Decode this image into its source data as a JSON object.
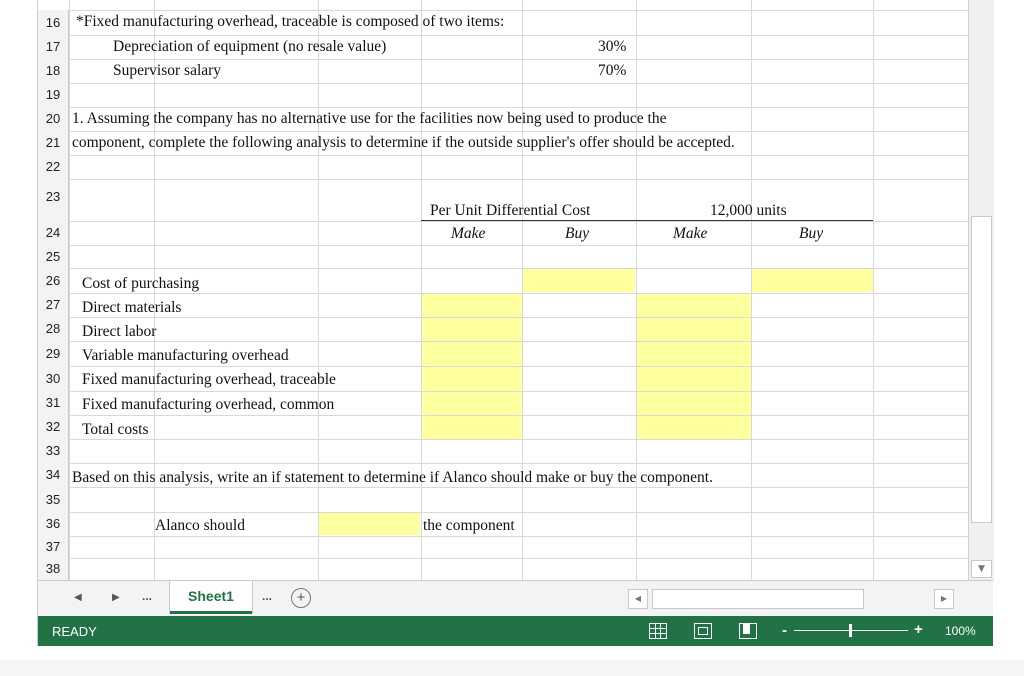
{
  "rows": [
    "16",
    "17",
    "18",
    "19",
    "20",
    "21",
    "22",
    "23",
    "24",
    "25",
    "26",
    "27",
    "28",
    "29",
    "30",
    "31",
    "32",
    "33",
    "34",
    "35",
    "36",
    "37",
    "38"
  ],
  "cells": {
    "r16": "*Fixed manufacturing overhead, traceable is composed of two items:",
    "r17_label": "Depreciation of equipment (no resale value)",
    "r17_value": "30%",
    "r18_label": "Supervisor salary",
    "r18_value": "70%",
    "r20": "1. Assuming the company has no alternative use for the facilities now being used to produce the",
    "r21": "component, complete the following analysis to determine if the outside supplier's offer should be accepted.",
    "r23_per_unit": "Per Unit Differential Cost",
    "r23_units": "12,000 units",
    "r24_make1": "Make",
    "r24_buy1": "Buy",
    "r24_make2": "Make",
    "r24_buy2": "Buy",
    "r26": "Cost of purchasing",
    "r27": "Direct materials",
    "r28": "Direct labor",
    "r29": "Variable manufacturing overhead",
    "r30": "Fixed manufacturing overhead, traceable",
    "r31": "Fixed manufacturing overhead, common",
    "r32": "Total costs",
    "r34": "Based on this analysis, write an if statement to determine if Alanco should make or buy the component.",
    "r36_label": "Alanco should",
    "r36_suffix": "the component"
  },
  "tabs": {
    "prev": "◀",
    "next": "▶",
    "ellipsis_left": "...",
    "sheet": "Sheet1",
    "ellipsis_right": "...",
    "add": "+"
  },
  "status": {
    "ready": "READY",
    "zoom": "100%",
    "zoom_minus": "-",
    "zoom_plus": "+"
  },
  "colors": {
    "accent": "#217346",
    "input_fill": "#ffff9f"
  },
  "icons": [
    "normal-view-icon",
    "page-layout-icon",
    "page-break-icon",
    "add-sheet-icon"
  ]
}
